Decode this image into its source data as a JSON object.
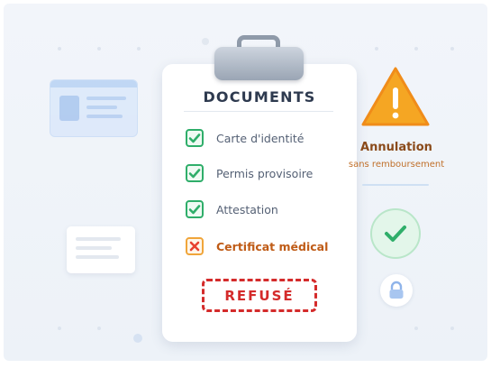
{
  "documents": {
    "title": "DOCUMENTS",
    "items": [
      {
        "label": "Carte d'identité",
        "status": "ok",
        "icon": "check-icon"
      },
      {
        "label": "Permis provisoire",
        "status": "ok",
        "icon": "check-icon"
      },
      {
        "label": "Attestation",
        "status": "ok",
        "icon": "check-icon"
      },
      {
        "label": "Certificat médical",
        "status": "refused",
        "icon": "cross-icon"
      }
    ],
    "stamp": "REFUSÉ"
  },
  "annulation": {
    "title": "Annulation",
    "subtitle": "sans remboursement",
    "icon": "warning-icon"
  },
  "colors": {
    "ok": "#2fae6a",
    "refused": "#d42b2b",
    "warning": "#f5a623",
    "title": "#2e3a4f"
  }
}
